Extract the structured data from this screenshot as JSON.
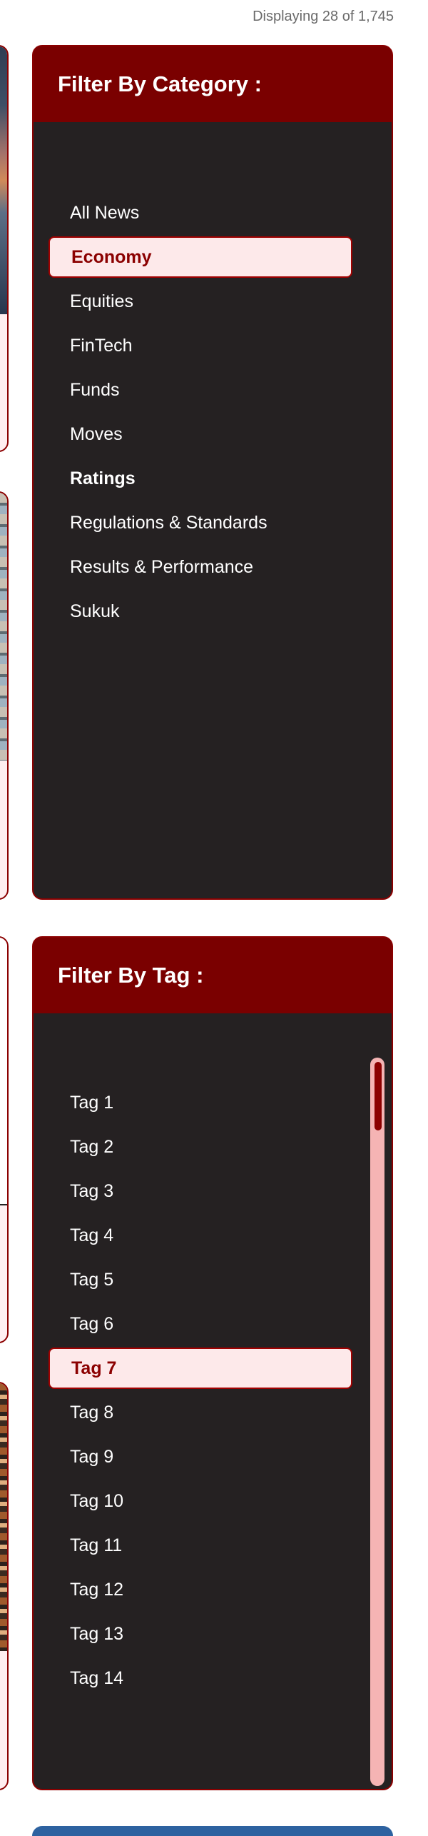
{
  "display_count": "Displaying 28 of 1,745",
  "category_filter": {
    "title": "Filter By Category :",
    "items": [
      {
        "label": "All News"
      },
      {
        "label": "Economy",
        "active": true
      },
      {
        "label": "Equities"
      },
      {
        "label": "FinTech"
      },
      {
        "label": "Funds"
      },
      {
        "label": "Moves"
      },
      {
        "label": "Ratings",
        "bold": true
      },
      {
        "label": "Regulations & Standards"
      },
      {
        "label": "Results & Performance"
      },
      {
        "label": "Sukuk"
      }
    ]
  },
  "tag_filter": {
    "title": "Filter By Tag :",
    "items": [
      {
        "label": "Tag 1"
      },
      {
        "label": "Tag 2"
      },
      {
        "label": "Tag 3"
      },
      {
        "label": "Tag 4"
      },
      {
        "label": "Tag 5"
      },
      {
        "label": "Tag 6"
      },
      {
        "label": "Tag 7",
        "active": true
      },
      {
        "label": "Tag 8"
      },
      {
        "label": "Tag 9"
      },
      {
        "label": "Tag 10"
      },
      {
        "label": "Tag 11"
      },
      {
        "label": "Tag 12"
      },
      {
        "label": "Tag 13"
      },
      {
        "label": "Tag 14"
      }
    ]
  },
  "colors": {
    "panel_header": "#7a0000",
    "panel_body": "#252122",
    "active_bg": "#fde9ea",
    "active_text": "#8b0000",
    "scroll_track": "#f5b4b4"
  }
}
